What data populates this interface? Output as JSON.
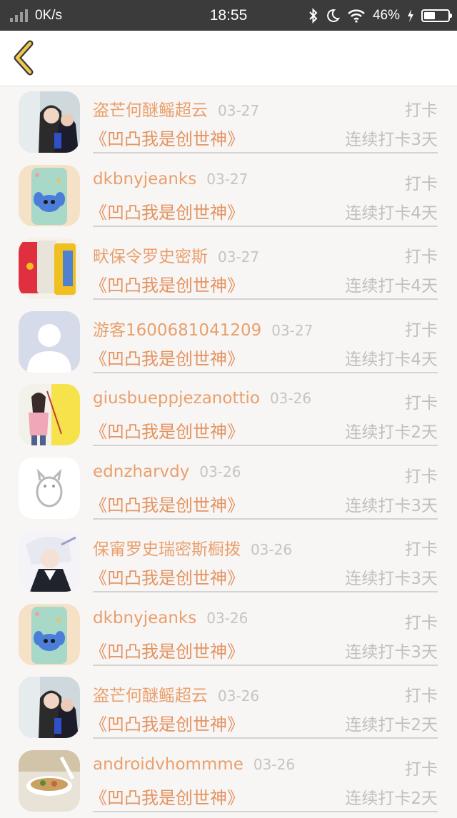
{
  "status_bar": {
    "speed": "0K/s",
    "time": "18:55",
    "battery": "46%",
    "battery_level": 0.46,
    "icons": [
      "signal-icon",
      "bluetooth-icon",
      "moon-icon",
      "wifi-icon",
      "battery-icon",
      "charging-icon"
    ]
  },
  "nav": {
    "back_icon": "chevron-left-icon"
  },
  "colors": {
    "accent": "#e8a06c",
    "muted": "#c4bebe",
    "background": "#f8f5f5"
  },
  "records": [
    {
      "name": "盗芒何醚鳐超云",
      "date": "03-27",
      "type": "打卡",
      "book": "《凹凸我是创世神》",
      "streak": "连续打卡3天",
      "avatar": "anime-couple"
    },
    {
      "name": "dkbnyjeanks",
      "date": "03-27",
      "type": "打卡",
      "book": "《凹凸我是创世神》",
      "streak": "连续打卡4天",
      "avatar": "stitch-phone-case"
    },
    {
      "name": "畎保令罗史密斯",
      "date": "03-27",
      "type": "打卡",
      "book": "《凹凸我是创世神》",
      "streak": "连续打卡4天",
      "avatar": "colorful-cases"
    },
    {
      "name": "游客1600681041209",
      "date": "03-27",
      "type": "打卡",
      "book": "《凹凸我是创世神》",
      "streak": "连续打卡4天",
      "avatar": "default-user"
    },
    {
      "name": "giusbueppjezanottio",
      "date": "03-26",
      "type": "打卡",
      "book": "《凹凸我是创世神》",
      "streak": "连续打卡2天",
      "avatar": "girl-photo"
    },
    {
      "name": "ednzharvdy",
      "date": "03-26",
      "type": "打卡",
      "book": "《凹凸我是创世神》",
      "streak": "连续打卡3天",
      "avatar": "totoro-sketch"
    },
    {
      "name": "保甯罗史瑞密斯橱拨",
      "date": "03-26",
      "type": "打卡",
      "book": "《凹凸我是创世神》",
      "streak": "连续打卡3天",
      "avatar": "anime-boy"
    },
    {
      "name": "dkbnyjeanks",
      "date": "03-26",
      "type": "打卡",
      "book": "《凹凸我是创世神》",
      "streak": "连续打卡3天",
      "avatar": "stitch-phone-case"
    },
    {
      "name": "盗芒何醚鳐超云",
      "date": "03-26",
      "type": "打卡",
      "book": "《凹凸我是创世神》",
      "streak": "连续打卡2天",
      "avatar": "anime-couple"
    },
    {
      "name": "androidvhommme",
      "date": "03-26",
      "type": "打卡",
      "book": "《凹凸我是创世神》",
      "streak": "连续打卡2天",
      "avatar": "food-bowl"
    }
  ]
}
